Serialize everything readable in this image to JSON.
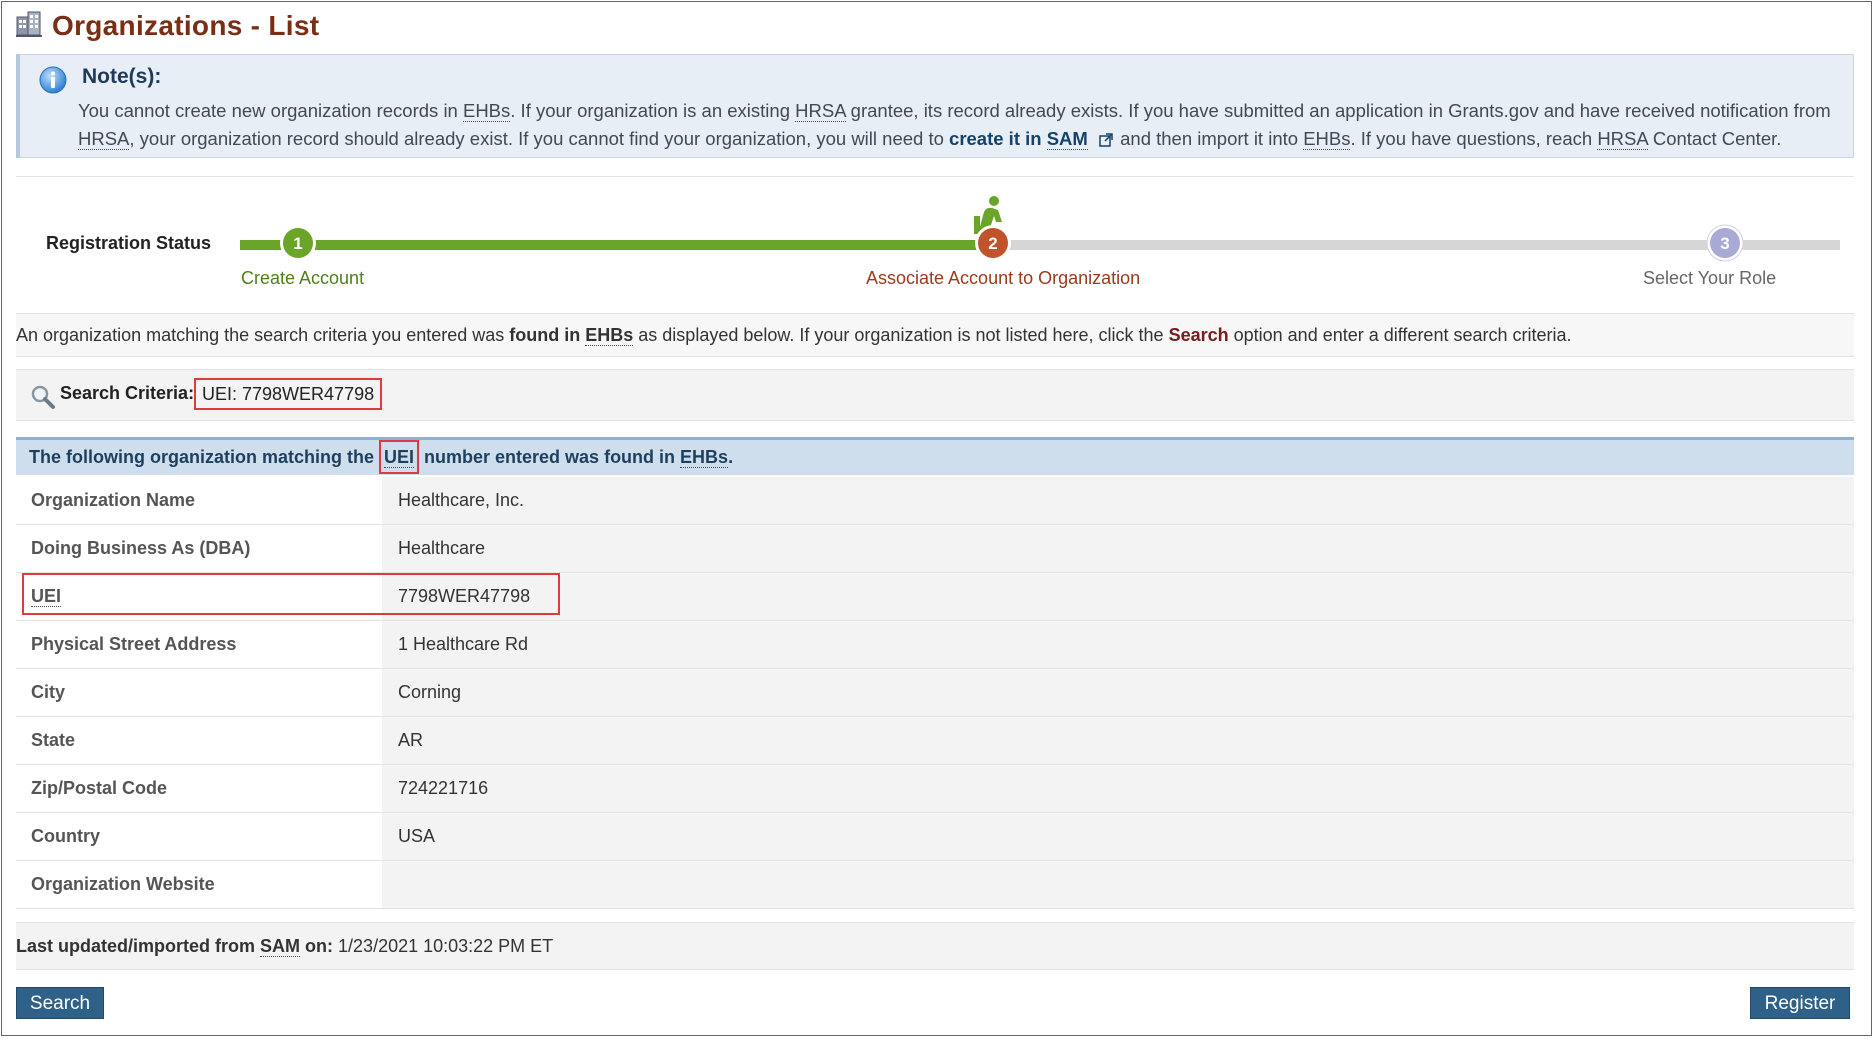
{
  "page": {
    "title": "Organizations - List"
  },
  "note": {
    "heading": "Note(s):",
    "line1_a": "You cannot create new organization records in ",
    "ehbs": "EHBs",
    "line1_b": ". If your organization is an existing ",
    "hrsa": "HRSA",
    "line1_c": " grantee, its record already exists. If you have submitted an application in Grants.gov and have received notification from",
    "line2_b": ", your organization record should already exist. If you cannot find your organization, you will need to ",
    "create_link": "create it in ",
    "sam": "SAM",
    "line2_c": " and then import it into ",
    "line2_d": ". If you have questions, reach ",
    "line2_e": " Contact Center."
  },
  "registration": {
    "label": "Registration Status",
    "steps": [
      {
        "number": "1",
        "label": "Create Account"
      },
      {
        "number": "2",
        "label": "Associate Account to Organization"
      },
      {
        "number": "3",
        "label": "Select Your Role"
      }
    ]
  },
  "message": {
    "a": "An organization matching the search criteria you entered was ",
    "b": "found in ",
    "ehbs": "EHBs",
    "c": " as displayed below. If your organization is not listed here, click the ",
    "search": "Search",
    "d": " option and enter a different search criteria."
  },
  "criteria": {
    "label": "Search Criteria:",
    "value": "UEI: 7798WER47798"
  },
  "found": {
    "a": "The following organization matching the ",
    "uei": "UEI",
    "b": " number entered was found in ",
    "ehbs": "EHBs",
    "c": "."
  },
  "org": {
    "rows": [
      {
        "label": "Organization Name",
        "value": "Healthcare, Inc."
      },
      {
        "label": "Doing Business As (DBA)",
        "value": "Healthcare"
      },
      {
        "label": "UEI",
        "value": "7798WER47798"
      },
      {
        "label": "Physical Street Address",
        "value": "1 Healthcare Rd"
      },
      {
        "label": "City",
        "value": "Corning"
      },
      {
        "label": "State",
        "value": "AR"
      },
      {
        "label": "Zip/Postal Code",
        "value": "724221716"
      },
      {
        "label": "Country",
        "value": "USA"
      },
      {
        "label": "Organization Website",
        "value": ""
      }
    ]
  },
  "updated": {
    "label_a": "Last updated/imported from ",
    "sam": "SAM",
    "label_b": " on:",
    "value": "1/23/2021 10:03:22 PM ET"
  },
  "buttons": {
    "search": "Search",
    "register": "Register"
  },
  "colors": {
    "title": "#7a2e15",
    "step_done": "#6aa428",
    "step_current": "#c0532b",
    "step_todo": "#a9a9d6",
    "button": "#2f6188",
    "highlight": "#e0393e"
  },
  "icons": {
    "title": "organization-building-icon",
    "note": "info-icon",
    "external": "external-link-icon",
    "search": "magnifier-icon",
    "current_step": "person-at-desk-icon"
  }
}
